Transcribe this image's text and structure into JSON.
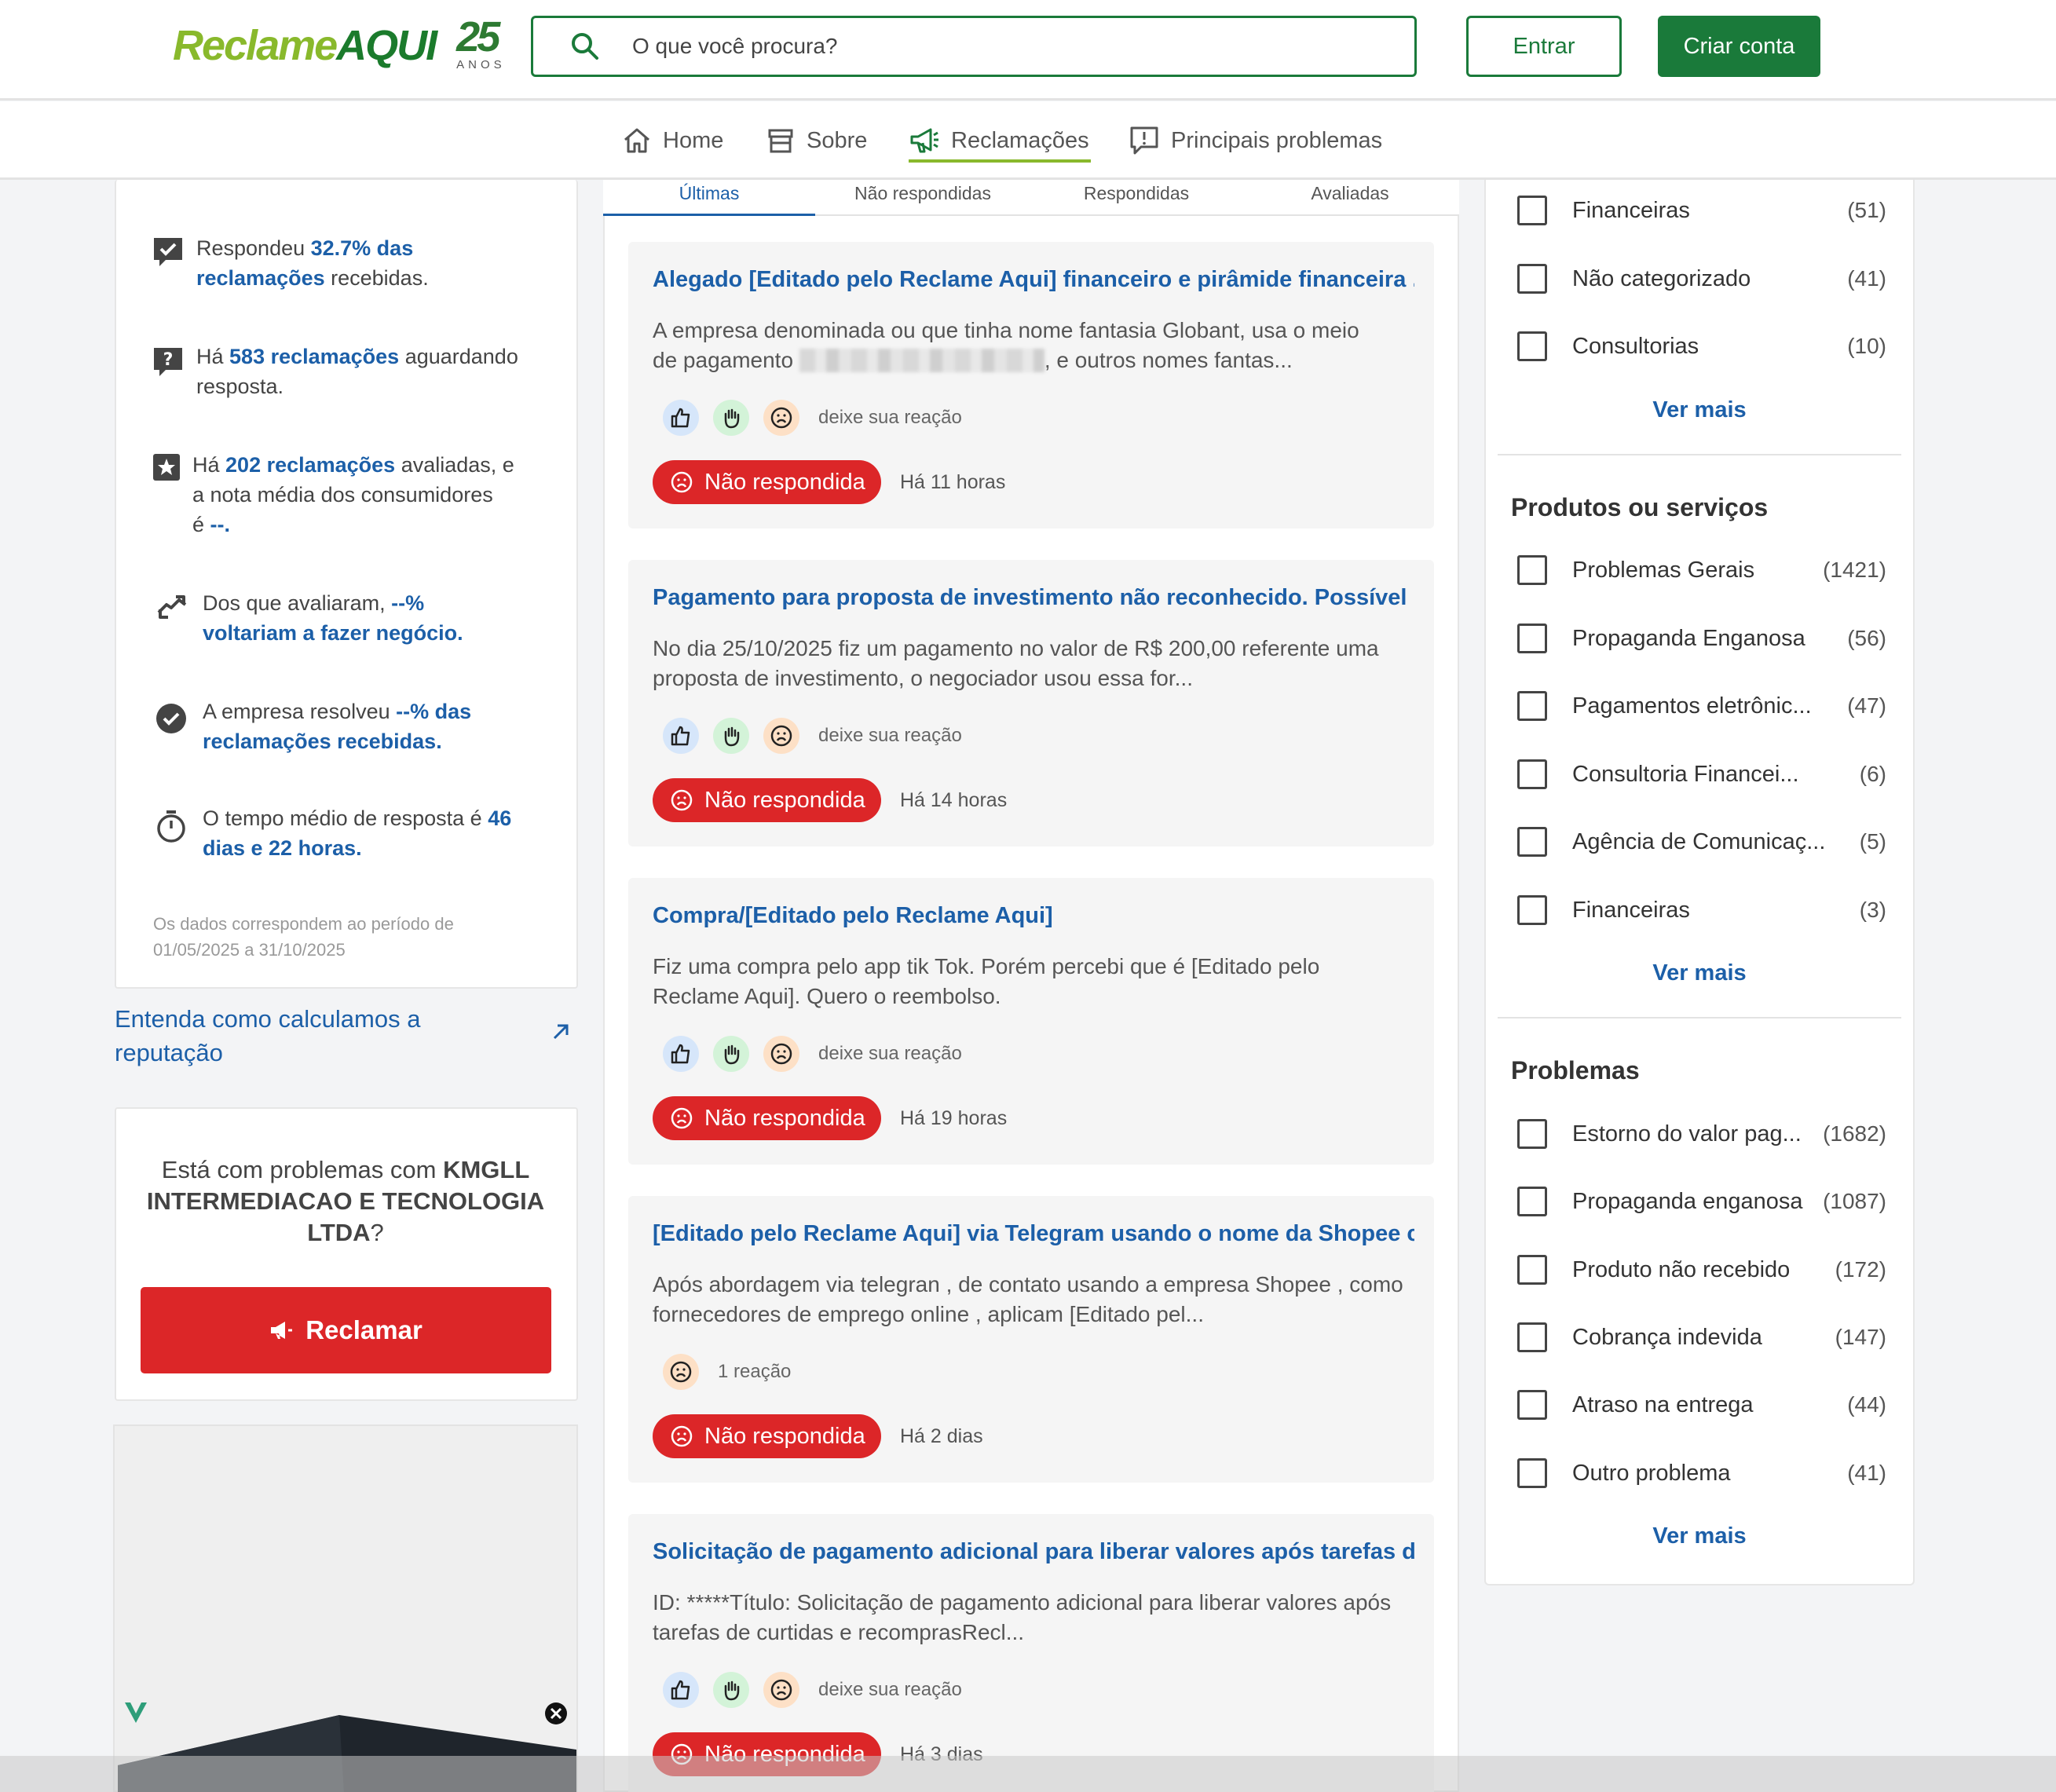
{
  "header": {
    "logo_reclame": "Reclame",
    "logo_aqui": "AQUI",
    "logo_years": "25",
    "logo_anos": "ANOS",
    "search_placeholder": "O que você procura?",
    "login_label": "Entrar",
    "signup_label": "Criar conta",
    "colors": {
      "brand_green": "#1a7a3a",
      "light_green": "#89b92c"
    }
  },
  "nav": {
    "items": [
      {
        "label": "Home",
        "icon": "home-icon"
      },
      {
        "label": "Sobre",
        "icon": "store-icon"
      },
      {
        "label": "Reclamações",
        "icon": "megaphone-icon",
        "active": true
      },
      {
        "label": "Principais problemas",
        "icon": "alert-message-icon"
      }
    ]
  },
  "stats": {
    "responded_pre": "Respondeu ",
    "responded_hl1": "32.7% das",
    "responded_hl2": "reclamações",
    "responded_post": " recebidas.",
    "waiting_pre": "Há ",
    "waiting_hl": "583 reclamações",
    "waiting_post1": " aguardando",
    "waiting_post2": "resposta.",
    "rated_pre": "Há ",
    "rated_hl": "202 reclamações",
    "rated_post1": " avaliadas, e",
    "rated_post2": "a nota média dos consumidores",
    "rated_post3": "é ",
    "rated_hl2": "--.",
    "back_pre": "Dos que avaliaram, ",
    "back_hl1": "--%",
    "back_hl2": "voltariam a fazer negócio.",
    "resolved_pre": "A empresa resolveu ",
    "resolved_hl1": "--% das",
    "resolved_hl2": "reclamações recebidas.",
    "time_pre": "O tempo médio de resposta é ",
    "time_hl1": "46",
    "time_hl2": "dias e 22 horas.",
    "period_line1": "Os dados correspondem ao período de",
    "period_line2": "01/05/2025 a 31/10/2025"
  },
  "reputation_link": "Entenda como calculamos a reputação",
  "cta": {
    "text_pre": "Está com problemas com ",
    "company": "KMGLL INTERMEDIACAO E TECNOLOGIA LTDA",
    "text_post": "?",
    "button": "Reclamar"
  },
  "tabs": [
    "Últimas",
    "Não respondidas",
    "Respondidas",
    "Avaliadas"
  ],
  "complaints": [
    {
      "title": "Alegado [Editado pelo Reclame Aqui] financeiro e pirâmide financeira ...",
      "desc_line1": "A empresa denominada ou que tinha nome fantasia Globant, usa o meio",
      "desc_line2_pre": "de pagamento ",
      "desc_line2_post": ", e outros nomes fantas...",
      "reaction_label": "deixe sua reação",
      "status": "Não respondida",
      "time": "Há 11 horas"
    },
    {
      "title": "Pagamento para proposta de investimento não reconhecido. Possível [...",
      "desc": "No dia 25/10/2025 fiz um pagamento no valor de R$ 200,00 referente uma proposta de investimento, o negociador usou essa for...",
      "reaction_label": "deixe sua reação",
      "status": "Não respondida",
      "time": "Há 14 horas"
    },
    {
      "title": "Compra/[Editado pelo Reclame Aqui]",
      "desc": "Fiz uma compra pelo app tik Tok. Porém percebi que é [Editado pelo Reclame Aqui]. Quero o reembolso.",
      "reaction_label": "deixe sua reação",
      "status": "Não respondida",
      "time": "Há 19 horas"
    },
    {
      "title": "[Editado pelo Reclame Aqui] via Telegram usando o nome da Shopee c...",
      "desc": "Após abordagem via telegran , de contato usando a empresa Shopee , como fornecedores de emprego online , aplicam [Editado pel...",
      "reaction_label": "1 reação",
      "status": "Não respondida",
      "time": "Há 2 dias"
    },
    {
      "title": "Solicitação de pagamento adicional para liberar valores após tarefas d...",
      "desc": "ID: *****Título: Solicitação de pagamento adicional para liberar valores após tarefas de curtidas e recomprasRecl...",
      "reaction_label": "deixe sua reação",
      "status": "Não respondida",
      "time": "Há 3 dias"
    }
  ],
  "filters": {
    "categories": [
      {
        "label": "Financeiras",
        "count": "(51)"
      },
      {
        "label": "Não categorizado",
        "count": "(41)"
      },
      {
        "label": "Consultorias",
        "count": "(10)"
      }
    ],
    "products_title": "Produtos ou serviços",
    "products": [
      {
        "label": "Problemas Gerais",
        "count": "(1421)"
      },
      {
        "label": "Propaganda Enganosa",
        "count": "(56)"
      },
      {
        "label": "Pagamentos eletrônic...",
        "count": "(47)"
      },
      {
        "label": "Consultoria Financei...",
        "count": "(6)"
      },
      {
        "label": "Agência de Comunicaç...",
        "count": "(5)"
      },
      {
        "label": "Financeiras",
        "count": "(3)"
      }
    ],
    "problems_title": "Problemas",
    "problems": [
      {
        "label": "Estorno do valor pag...",
        "count": "(1682)"
      },
      {
        "label": "Propaganda enganosa",
        "count": "(1087)"
      },
      {
        "label": "Produto não recebido",
        "count": "(172)"
      },
      {
        "label": "Cobrança indevida",
        "count": "(147)"
      },
      {
        "label": "Atraso na entrega",
        "count": "(44)"
      },
      {
        "label": "Outro problema",
        "count": "(41)"
      }
    ],
    "see_more": "Ver mais"
  }
}
